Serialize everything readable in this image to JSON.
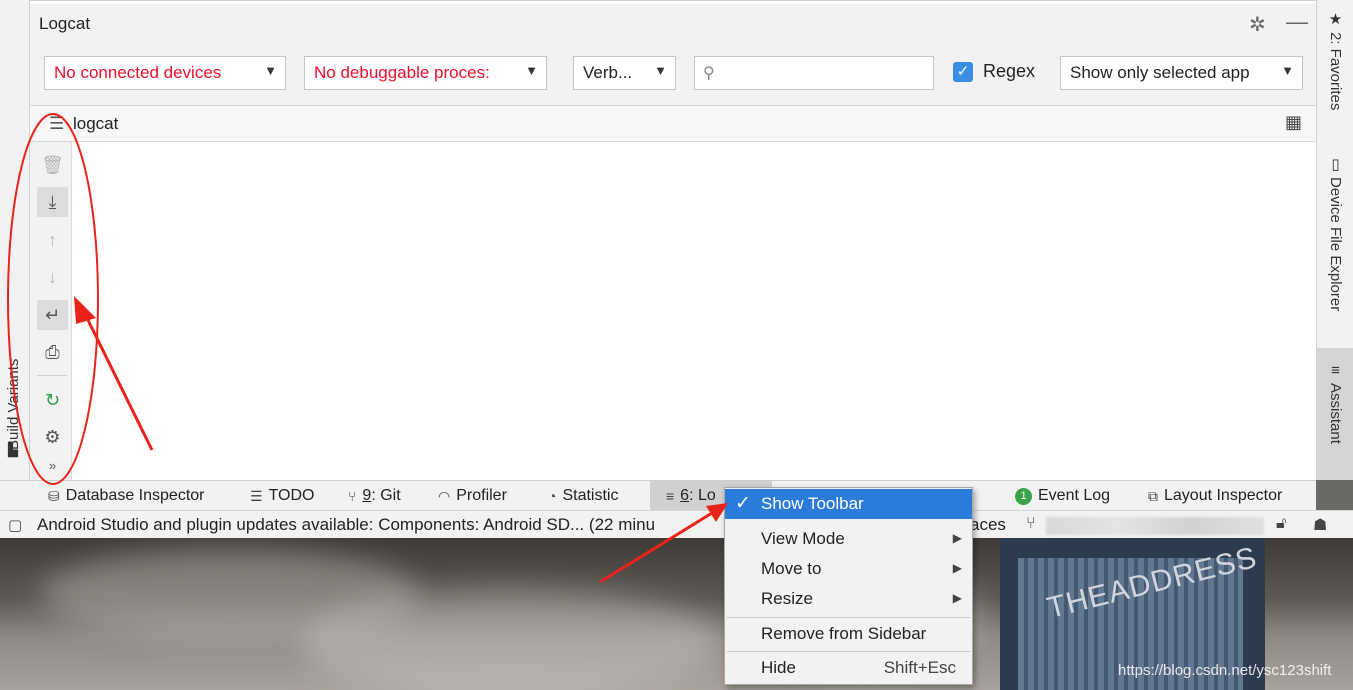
{
  "toolwindow": {
    "title": "Logcat",
    "settings_icon": "gear-icon",
    "minimize_icon": "minimize-icon"
  },
  "filters": {
    "device": "No connected devices",
    "process": "No debuggable proces:",
    "level": "Verb...",
    "search_placeholder": "",
    "regex_label": "Regex",
    "regex_checked": true,
    "app_filter": "Show only selected app"
  },
  "logcat_tab": {
    "label": "logcat"
  },
  "sidebar_tools": [
    "trash-icon",
    "scroll-to-end-icon",
    "up-arrow-icon",
    "down-arrow-icon",
    "soft-wrap-icon",
    "print-icon",
    "restart-icon",
    "settings-icon",
    "more-icon"
  ],
  "left_strip": {
    "label": "Build Variants"
  },
  "right_strip": {
    "favorites": "2: Favorites",
    "device_file_explorer": "Device File Explorer",
    "assistant": "Assistant"
  },
  "bottom_tabs": {
    "database_inspector": "Database Inspector",
    "todo": "TODO",
    "git_num": "9",
    "git": ": Git",
    "profiler": "Profiler",
    "statistic": "Statistic",
    "logcat_num": "6",
    "logcat_short": ": Lo",
    "event_log": "Event Log",
    "event_log_count": "1",
    "layout_inspector": "Layout Inspector"
  },
  "status": {
    "message": "Android Studio and plugin updates available: Components: Android SD... (22 minu",
    "right_fragment": "aces"
  },
  "context_menu": {
    "show_toolbar": "Show Toolbar",
    "view_mode": "View Mode",
    "move_to": "Move to",
    "resize": "Resize",
    "remove_from_sidebar": "Remove from Sidebar",
    "hide": "Hide",
    "hide_shortcut": "Shift+Esc"
  },
  "desktop": {
    "building_sign": "THEADDRESS",
    "watermark": "https://blog.csdn.net/ysc123shift"
  },
  "colors": {
    "accent": "#2b7bdb",
    "error_text": "#e8112d",
    "annotation": "#e8231a"
  }
}
